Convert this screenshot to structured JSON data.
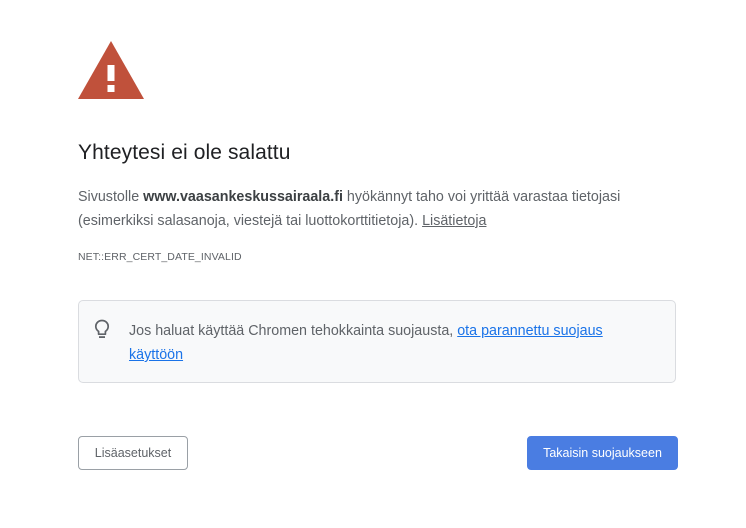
{
  "warning_icon": "red-triangle-exclamation-icon",
  "title": "Yhteytesi ei ole salattu",
  "description": {
    "prefix": "Sivustolle ",
    "site": "www.vaasankeskussairaala.fi",
    "suffix": " hyökännyt taho voi yrittää varastaa tietojasi (esimerkiksi salasanoja, viestejä tai luottokorttitietoja). ",
    "learn_more": "Lisätietoja"
  },
  "error_code": "NET::ERR_CERT_DATE_INVALID",
  "enhanced_protection": {
    "icon": "lightbulb-icon",
    "text": "Jos haluat käyttää Chromen tehokkainta suojausta, ",
    "link": "ota parannettu suojaus käyttöön"
  },
  "buttons": {
    "advanced": "Lisäasetukset",
    "back_to_safety": "Takaisin suojaukseen"
  },
  "colors": {
    "warning_red": "#c0513b",
    "primary_blue": "#4a7de2",
    "link_blue": "#1a73e8",
    "text_grey": "#5f6368"
  }
}
